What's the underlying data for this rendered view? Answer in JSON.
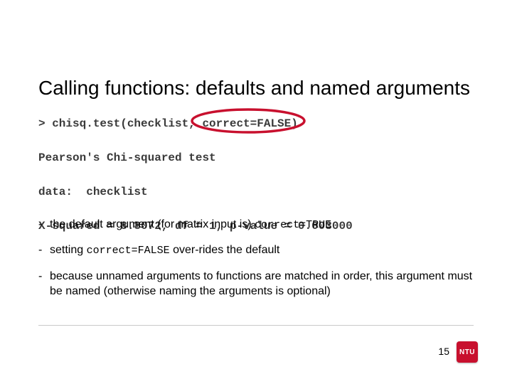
{
  "title": "Calling functions: defaults and named arguments",
  "code": {
    "l1": "> chisq.test(checklist, correct=FALSE)",
    "l2": " ",
    "l3": "Pearson's Chi-squared test",
    "l4": " ",
    "l5": "data:  checklist",
    "l6": " ",
    "l7": "X-squared = 8.8072, df = 1, p-value = 0.003000"
  },
  "bullets": {
    "b1a": "the default argument (for matrix input is) ",
    "b1b": "correct=TRUE",
    "b2a": "setting ",
    "b2b": "correct=FALSE",
    "b2c": " over-rides the default",
    "b3": "because unnamed arguments to functions are matched in order, this argument must be named (otherwise naming the arguments is optional)"
  },
  "page_number": "15",
  "logo_text": "NTU",
  "colors": {
    "accent": "#c8102e"
  }
}
